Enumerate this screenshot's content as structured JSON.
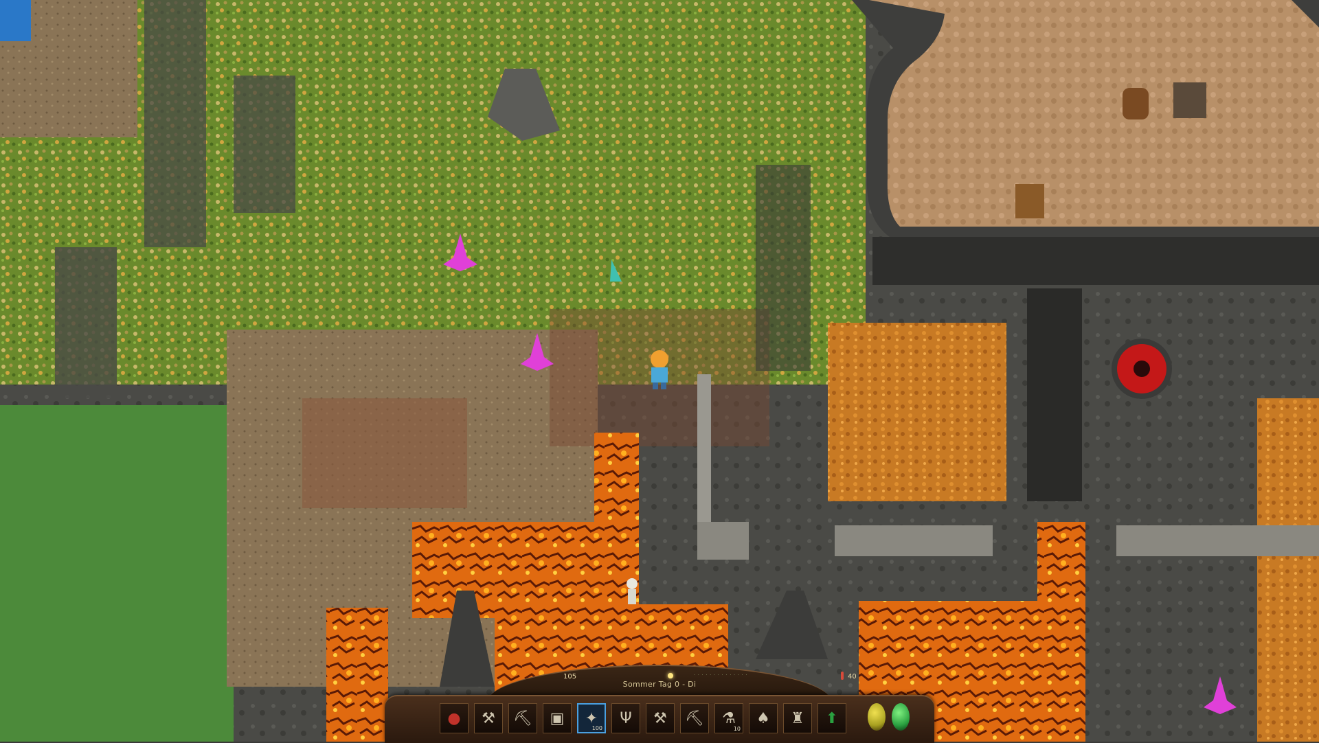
{
  "hud": {
    "day_label": "Sommer Tag 0 - Di",
    "gold": "105",
    "temperature": "40",
    "hotbar": [
      {
        "icon": "red-orb-icon",
        "qty": ""
      },
      {
        "icon": "hatchet-icon",
        "qty": ""
      },
      {
        "icon": "pickaxe-icon",
        "qty": ""
      },
      {
        "icon": "bucket-icon",
        "qty": ""
      },
      {
        "icon": "magic-scroll-icon",
        "qty": "100"
      },
      {
        "icon": "trident-icon",
        "qty": ""
      },
      {
        "icon": "axe-icon",
        "qty": ""
      },
      {
        "icon": "pickaxe-icon",
        "qty": ""
      },
      {
        "icon": "potion-icon",
        "qty": "10"
      },
      {
        "icon": "shovel-icon",
        "qty": ""
      },
      {
        "icon": "armor-icon",
        "qty": ""
      },
      {
        "icon": "up-arrow-icon",
        "qty": ""
      }
    ],
    "selected_slot": 4,
    "colors": {
      "health": "#c0322a",
      "stamina": "#2aa040",
      "hunger": "#a8a020",
      "selection": "#4aa0e0"
    }
  }
}
